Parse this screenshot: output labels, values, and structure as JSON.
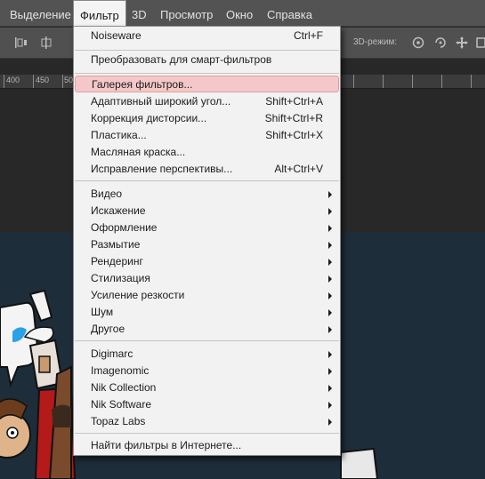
{
  "menubar": {
    "items": [
      "Выделение",
      "Фильтр",
      "3D",
      "Просмотр",
      "Окно",
      "Справка"
    ]
  },
  "optionsbar": {
    "label_3d": "3D-режим:",
    "icons": [
      "align-left-icon",
      "align-center-icon",
      "rotate-3d-icon",
      "roll-3d-icon",
      "pan-3d-icon",
      "slide-3d-icon",
      "scale-3d-icon"
    ]
  },
  "ruler": {
    "labels": [
      "400",
      "450",
      "50"
    ]
  },
  "filter_menu": {
    "groups": [
      [
        {
          "label": "Noiseware",
          "shortcut": "Ctrl+F"
        }
      ],
      [
        {
          "label": "Преобразовать для смарт-фильтров"
        }
      ],
      [
        {
          "label": "Галерея фильтров...",
          "highlighted": true
        },
        {
          "label": "Адаптивный широкий угол...",
          "shortcut": "Shift+Ctrl+A"
        },
        {
          "label": "Коррекция дисторсии...",
          "shortcut": "Shift+Ctrl+R"
        },
        {
          "label": "Пластика...",
          "shortcut": "Shift+Ctrl+X"
        },
        {
          "label": "Масляная краска..."
        },
        {
          "label": "Исправление перспективы...",
          "shortcut": "Alt+Ctrl+V"
        }
      ],
      [
        {
          "label": "Видео",
          "submenu": true
        },
        {
          "label": "Искажение",
          "submenu": true
        },
        {
          "label": "Оформление",
          "submenu": true
        },
        {
          "label": "Размытие",
          "submenu": true
        },
        {
          "label": "Рендеринг",
          "submenu": true
        },
        {
          "label": "Стилизация",
          "submenu": true
        },
        {
          "label": "Усиление резкости",
          "submenu": true
        },
        {
          "label": "Шум",
          "submenu": true
        },
        {
          "label": "Другое",
          "submenu": true
        }
      ],
      [
        {
          "label": "Digimarc",
          "submenu": true
        },
        {
          "label": "Imagenomic",
          "submenu": true
        },
        {
          "label": "Nik Collection",
          "submenu": true
        },
        {
          "label": "Nik Software",
          "submenu": true
        },
        {
          "label": "Topaz Labs",
          "submenu": true
        }
      ],
      [
        {
          "label": "Найти фильтры в Интернете..."
        }
      ]
    ]
  },
  "colors": {
    "menubar_bg": "#535353",
    "menu_bg": "#f2f2f2",
    "highlight": "#f4c8c8",
    "artwork_bg": "#1e2d3a"
  }
}
